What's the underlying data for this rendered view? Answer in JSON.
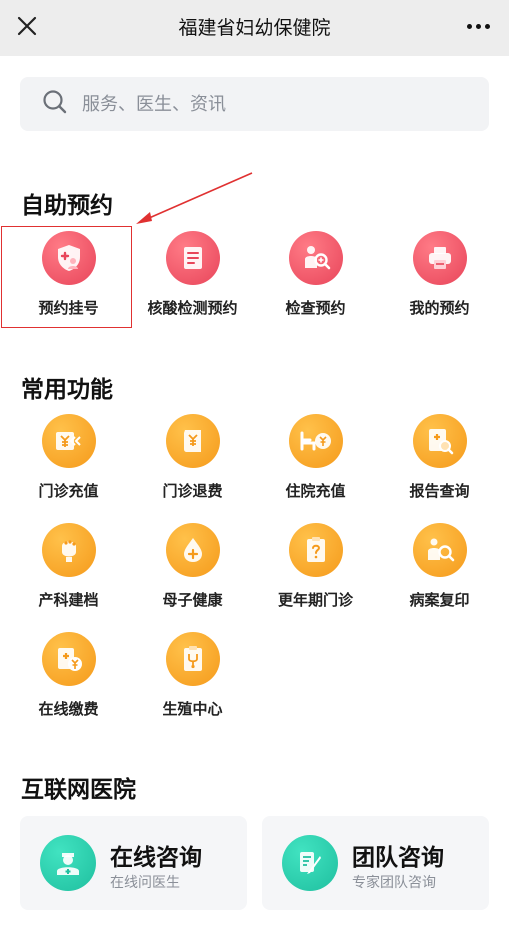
{
  "header": {
    "title": "福建省妇幼保健院",
    "close_icon": "close-icon",
    "more_icon": "more-icon"
  },
  "search": {
    "placeholder": "服务、医生、资讯",
    "value": "",
    "icon": "search-icon"
  },
  "sections": {
    "self_booking": {
      "title": "自助预约",
      "items": [
        {
          "label": "预约挂号",
          "icon": "shield-plus-icon"
        },
        {
          "label": "核酸检测预约",
          "icon": "receipt-icon"
        },
        {
          "label": "检查预约",
          "icon": "examine-icon"
        },
        {
          "label": "我的预约",
          "icon": "printer-icon"
        }
      ]
    },
    "common": {
      "title": "常用功能",
      "items": [
        {
          "label": "门诊充值",
          "icon": "yuan-card-icon"
        },
        {
          "label": "门诊退费",
          "icon": "refund-scroll-icon"
        },
        {
          "label": "住院充值",
          "icon": "bed-yuan-icon"
        },
        {
          "label": "报告查询",
          "icon": "report-search-icon"
        },
        {
          "label": "产科建档",
          "icon": "baby-head-icon"
        },
        {
          "label": "母子健康",
          "icon": "drop-plus-icon"
        },
        {
          "label": "更年期门诊",
          "icon": "question-clipboard-icon"
        },
        {
          "label": "病案复印",
          "icon": "record-copy-icon"
        },
        {
          "label": "在线缴费",
          "icon": "online-pay-icon"
        },
        {
          "label": "生殖中心",
          "icon": "clipboard-stethoscope-icon"
        }
      ]
    },
    "internet": {
      "title": "互联网医院",
      "cards": [
        {
          "title": "在线咨询",
          "subtitle": "在线问医生",
          "icon": "doctor-icon"
        },
        {
          "title": "团队咨询",
          "subtitle": "专家团队咨询",
          "icon": "team-consult-icon"
        }
      ]
    }
  },
  "colors": {
    "header_bg": "#ededed",
    "red_accent": "#e8455a",
    "orange_accent": "#f59a1b",
    "teal_accent": "#1fbf9f",
    "annotation_red": "#e03131"
  }
}
